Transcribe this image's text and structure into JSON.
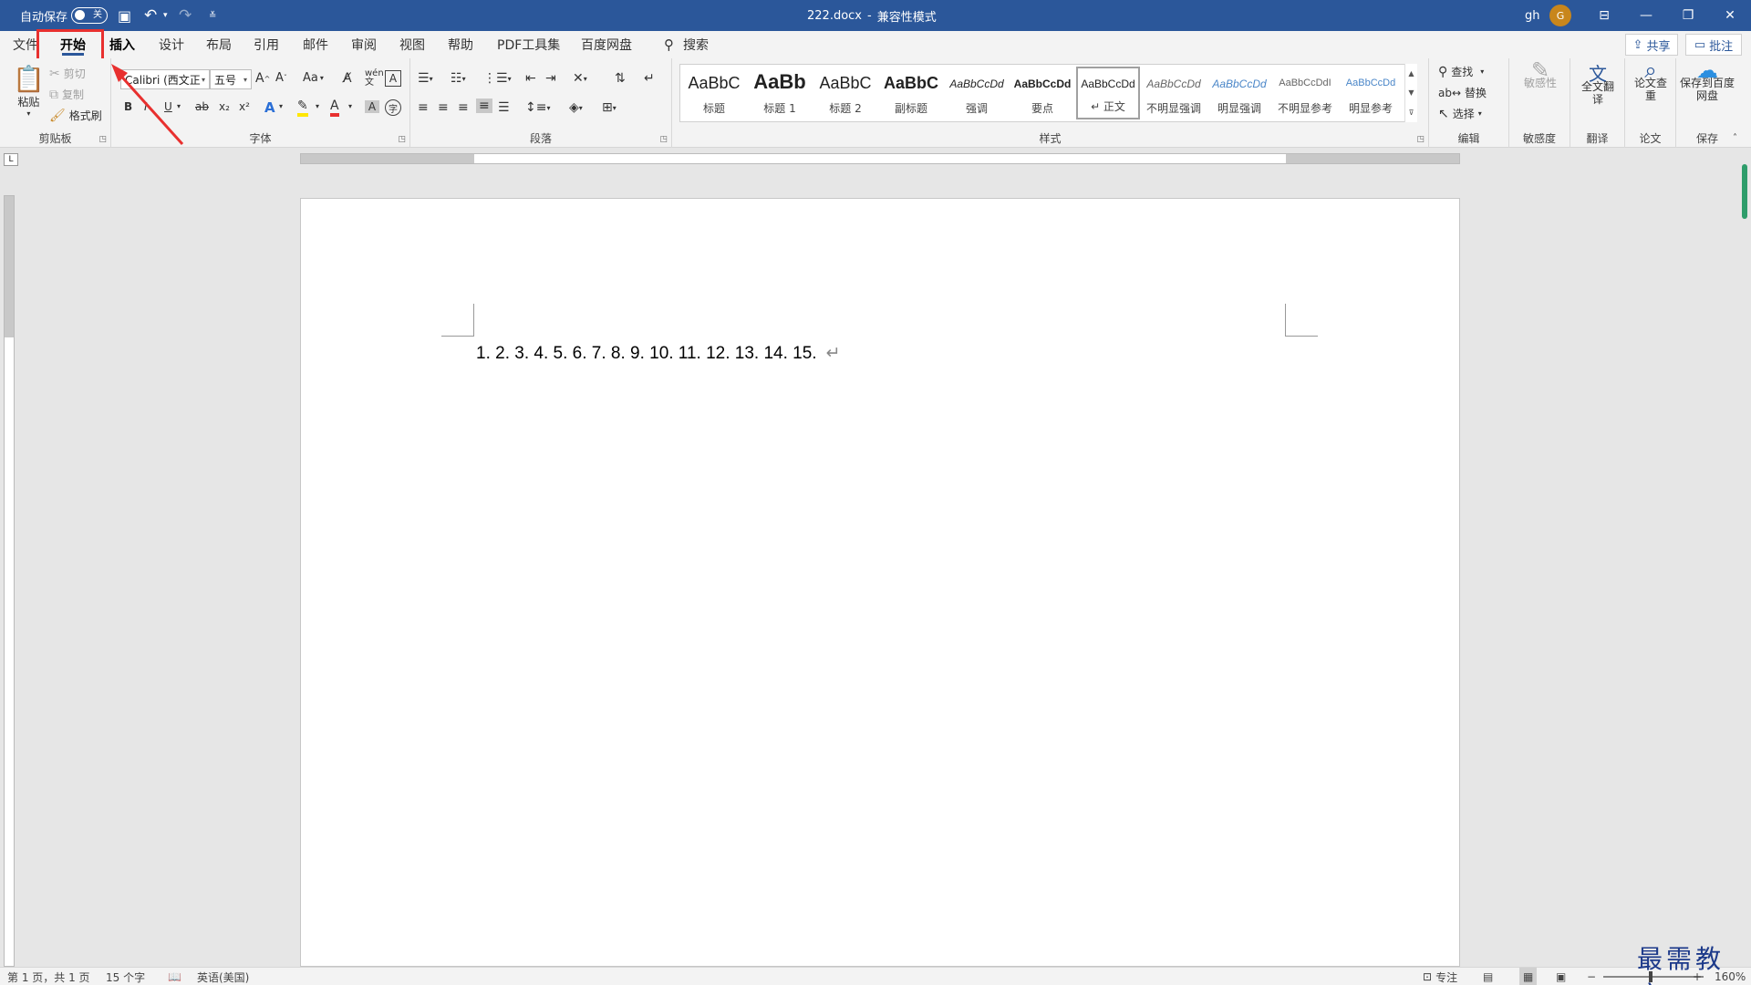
{
  "titlebar": {
    "autosave_label": "自动保存",
    "autosave_state": "关",
    "doc_title": "222.docx",
    "separator": "-",
    "mode": "兼容性模式",
    "user": "gh",
    "avatar_initial": "G"
  },
  "tabs": [
    {
      "label": "文件"
    },
    {
      "label": "开始"
    },
    {
      "label": "插入"
    },
    {
      "label": "设计"
    },
    {
      "label": "布局"
    },
    {
      "label": "引用"
    },
    {
      "label": "邮件"
    },
    {
      "label": "审阅"
    },
    {
      "label": "视图"
    },
    {
      "label": "帮助"
    },
    {
      "label": "PDF工具集"
    },
    {
      "label": "百度网盘"
    }
  ],
  "search_label": "搜索",
  "share_label": "共享",
  "comment_label": "批注",
  "ribbon": {
    "clipboard": {
      "paste": "粘贴",
      "cut": "剪切",
      "copy": "复制",
      "format_painter": "格式刷",
      "label": "剪贴板"
    },
    "font": {
      "font_name": "Calibri (西文正",
      "font_size": "五号",
      "change_case": "Aa",
      "label": "字体",
      "bold": "B",
      "italic": "I",
      "underline": "U",
      "strike": "ab",
      "sub": "x₂",
      "sup": "x²",
      "text_effect": "A",
      "font_color": "A",
      "char_shading": "A",
      "enclose": "字"
    },
    "paragraph": {
      "label": "段落"
    },
    "styles": {
      "label": "样式",
      "items": [
        {
          "sample": "AaBbC",
          "name": "标题"
        },
        {
          "sample": "AaBb",
          "name": "标题 1"
        },
        {
          "sample": "AaBbC",
          "name": "标题 2"
        },
        {
          "sample": "AaBbC",
          "name": "副标题"
        },
        {
          "sample": "AaBbCcDd",
          "name": "强调"
        },
        {
          "sample": "AaBbCcDd",
          "name": "要点"
        },
        {
          "sample": "AaBbCcDd",
          "name": "↵ 正文"
        },
        {
          "sample": "AaBbCcDd",
          "name": "不明显强调"
        },
        {
          "sample": "AaBbCcDd",
          "name": "明显强调"
        },
        {
          "sample": "AaBbCcDdI",
          "name": "不明显参考"
        },
        {
          "sample": "AaBbCcDd",
          "name": "明显参考"
        }
      ]
    },
    "editing": {
      "find": "查找",
      "replace": "替换",
      "select": "选择",
      "label": "编辑"
    },
    "sensitivity": {
      "button": "敏感性",
      "label": "敏感度"
    },
    "translate": {
      "button": "全文翻译",
      "label": "翻译"
    },
    "paper": {
      "button": "论文查重",
      "label": "论文"
    },
    "save": {
      "button": "保存到百度网盘",
      "label": "保存"
    }
  },
  "document": {
    "text": "1. 2. 3. 4. 5. 6. 7. 8. 9. 10. 11. 12. 13. 14. 15.",
    "para_mark": "↵"
  },
  "statusbar": {
    "page": "第 1 页，共 1 页",
    "words": "15 个字",
    "language": "英语(美国)",
    "focus": "专注",
    "zoom_minus": "−",
    "zoom_plus": "+",
    "zoom": "160%"
  },
  "watermark": "最需教育",
  "colors": {
    "accent": "#2b579a",
    "annotation": "#e8302f"
  }
}
